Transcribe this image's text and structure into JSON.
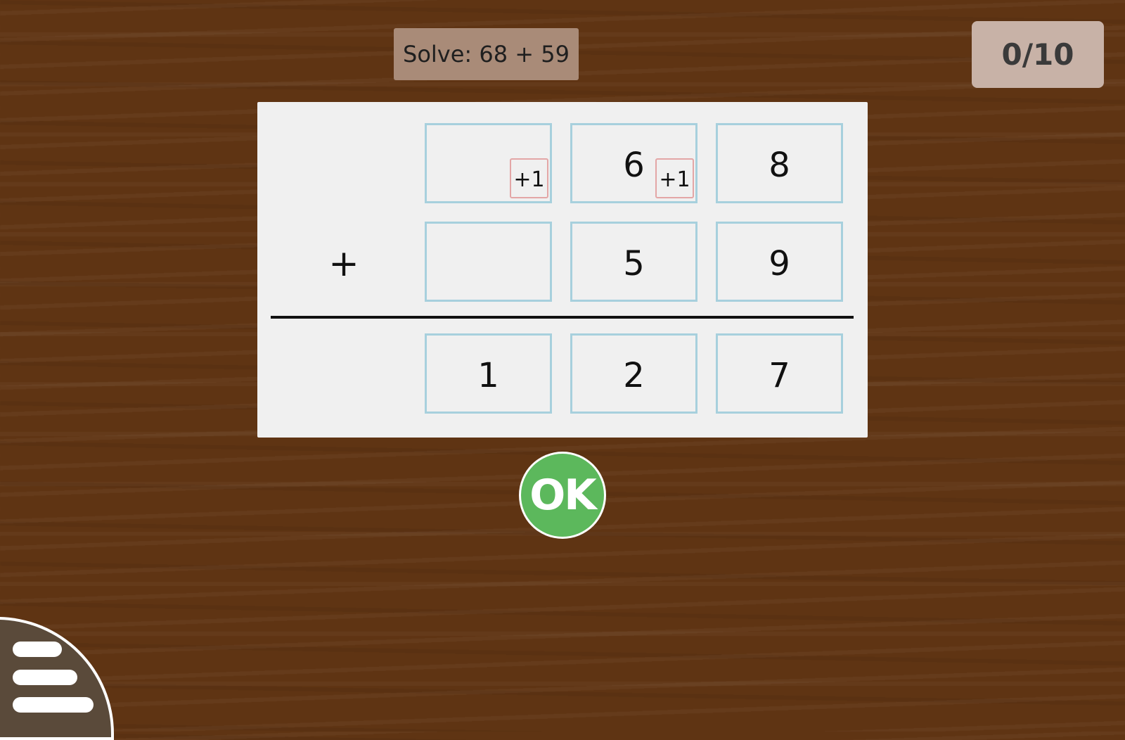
{
  "header": {
    "prompt": "Solve: 68 + 59",
    "score": "0/10"
  },
  "problem": {
    "operator": "+",
    "top_row": [
      "",
      "6",
      "8"
    ],
    "carry_marks": [
      "+1",
      "+1"
    ],
    "second_row": [
      "",
      "5",
      "9"
    ],
    "answer_row": [
      "1",
      "2",
      "7"
    ]
  },
  "actions": {
    "ok_label": "OK",
    "menu_icon": "hamburger-menu-icon"
  },
  "colors": {
    "background": "#5f3413",
    "board": "#f0f0f0",
    "cell_border": "#a7d0dd",
    "carry_border": "#e3a6a6",
    "ok_green": "#5cb85c"
  }
}
